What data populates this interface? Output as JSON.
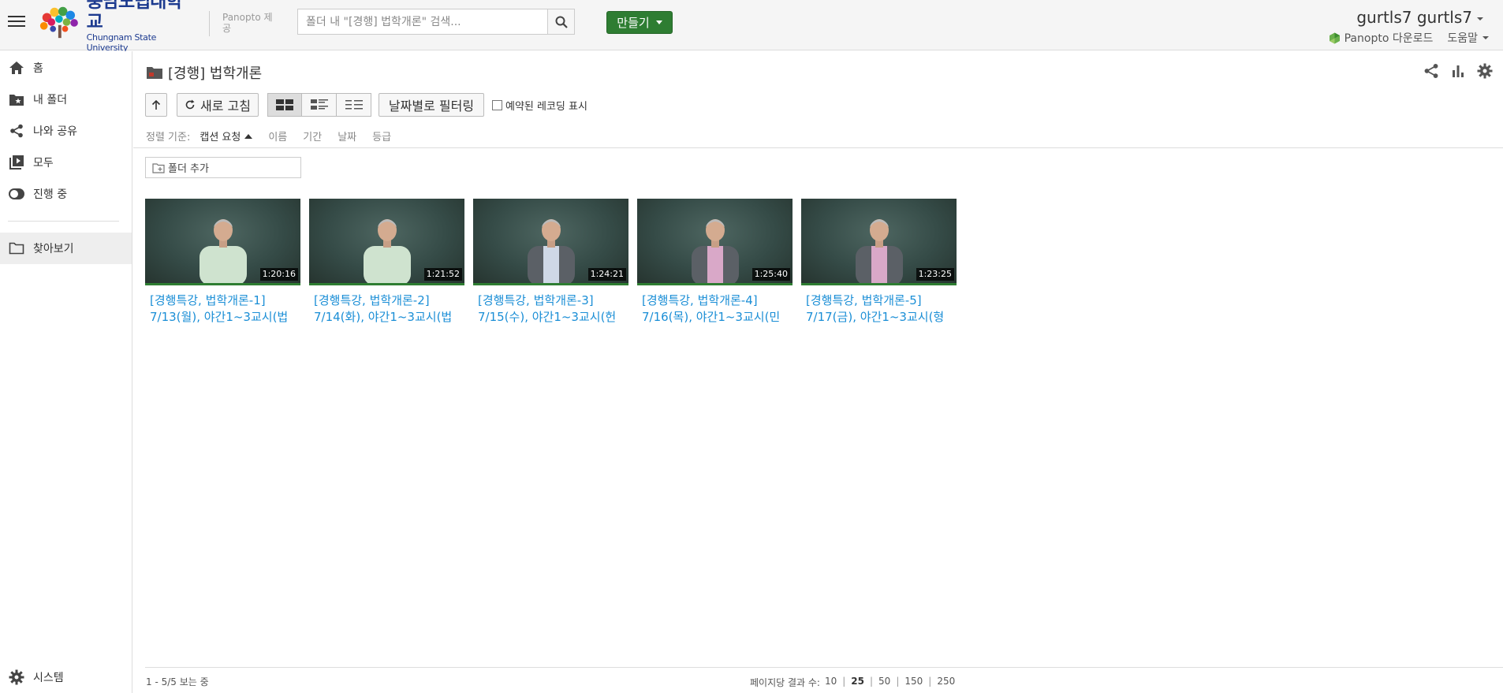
{
  "header": {
    "logo_ko": "충남도립대학교",
    "logo_en": "Chungnam State University",
    "provided_by": "Panopto 제공",
    "search_placeholder": "폴더 내 \"[경행] 법학개론\" 검색...",
    "create_label": "만들기",
    "user_name": "gurtls7 gurtls7",
    "download_label": "Panopto 다운로드",
    "help_label": "도움말",
    "accent_color": "#2e7d32"
  },
  "sidebar": {
    "items": [
      {
        "label": "홈",
        "icon": "home-icon"
      },
      {
        "label": "내 폴더",
        "icon": "folder-star-icon"
      },
      {
        "label": "나와 공유",
        "icon": "share-icon"
      },
      {
        "label": "모두",
        "icon": "playlist-icon"
      },
      {
        "label": "진행 중",
        "icon": "toggle-icon"
      }
    ],
    "browse_label": "찾아보기",
    "system_label": "시스템"
  },
  "main": {
    "folder_title": "[경행] 법학개론",
    "refresh_label": "새로 고침",
    "filter_label": "날짜별로 필터링",
    "scheduled_label": "예약된 레코딩 표시",
    "scheduled_checked": false,
    "sort": {
      "label": "정렬 기준:",
      "active": "캡션 요청",
      "options": [
        "이름",
        "기간",
        "날짜",
        "등급"
      ]
    },
    "add_folder_label": "폴더 추가",
    "sessions": [
      {
        "title_line1": "[경행특강, 법학개론-1]",
        "title_line2": "7/13(월), 야간1~3교시(법",
        "duration": "1:20:16",
        "shirt": "#cfe3cf",
        "jacket": ""
      },
      {
        "title_line1": "[경행특강, 법학개론-2]",
        "title_line2": "7/14(화), 야간1~3교시(법",
        "duration": "1:21:52",
        "shirt": "#cfe3cf",
        "jacket": ""
      },
      {
        "title_line1": "[경행특강, 법학개론-3]",
        "title_line2": "7/15(수), 야간1~3교시(헌",
        "duration": "1:24:21",
        "shirt": "#cfd8e6",
        "jacket": "#5b6066"
      },
      {
        "title_line1": "[경행특강, 법학개론-4]",
        "title_line2": "7/16(목), 야간1~3교시(민",
        "duration": "1:25:40",
        "shirt": "#d9a8c8",
        "jacket": "#5b6066"
      },
      {
        "title_line1": "[경행특강, 법학개론-5]",
        "title_line2": "7/17(금), 야간1~3교시(형",
        "duration": "1:23:25",
        "shirt": "#d9a8c8",
        "jacket": "#5b6066"
      }
    ]
  },
  "footer": {
    "count_text": "1 - 5/5 보는 중",
    "per_page_label": "페이지당 결과 수:",
    "per_page_options": [
      "10",
      "25",
      "50",
      "150",
      "250"
    ],
    "per_page_selected": "25"
  }
}
